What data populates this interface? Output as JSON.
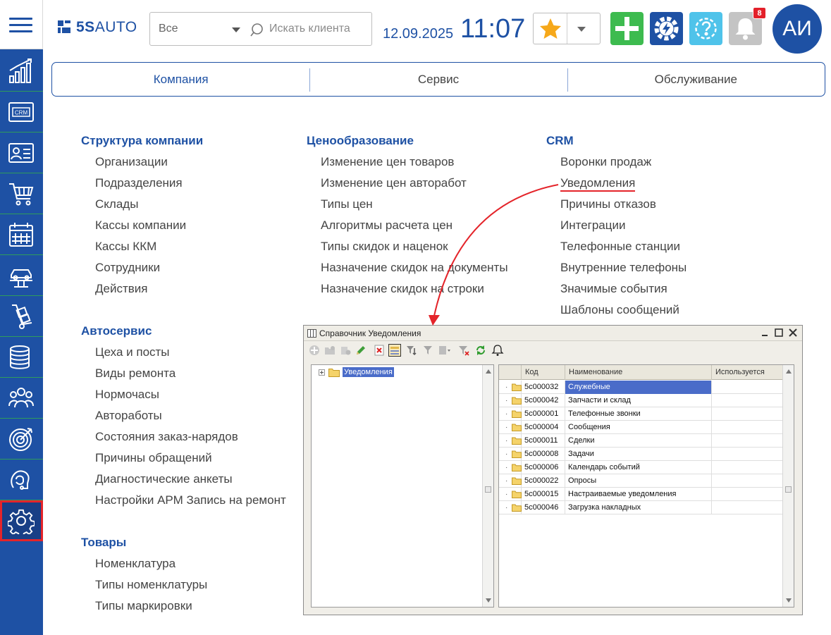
{
  "header": {
    "logo_text": "5SAUTO",
    "logo_brand": "5S",
    "logo_word": "AUTO",
    "scope_select": {
      "value": "Все"
    },
    "search": {
      "placeholder": "Искать клиента"
    },
    "date": "12.09.2025",
    "time": "11:07",
    "notification_count": "8",
    "avatar_initials": "АИ"
  },
  "sidebar": {
    "items": [
      {
        "name": "analytics",
        "icon": "chart-bars-icon"
      },
      {
        "name": "crm",
        "icon": "crm-icon",
        "label": "CRM"
      },
      {
        "name": "clients",
        "icon": "contact-card-icon"
      },
      {
        "name": "sales",
        "icon": "cart-icon"
      },
      {
        "name": "calendar",
        "icon": "calendar-icon"
      },
      {
        "name": "service",
        "icon": "car-lift-icon"
      },
      {
        "name": "warehouse",
        "icon": "hand-truck-icon"
      },
      {
        "name": "finance",
        "icon": "coins-icon"
      },
      {
        "name": "staff",
        "icon": "team-icon"
      },
      {
        "name": "marketing",
        "icon": "target-icon"
      },
      {
        "name": "support",
        "icon": "operator-icon"
      },
      {
        "name": "settings",
        "icon": "gear-icon",
        "active": true
      }
    ]
  },
  "tabs": [
    {
      "label": "Компания",
      "active": true
    },
    {
      "label": "Сервис"
    },
    {
      "label": "Обслуживание"
    }
  ],
  "sections": {
    "company": {
      "title": "Структура компании",
      "items": [
        "Организации",
        "Подразделения",
        "Склады",
        "Кассы компании",
        "Кассы ККМ",
        "Сотрудники",
        "Действия"
      ]
    },
    "pricing": {
      "title": "Ценообразование",
      "items": [
        "Изменение цен товаров",
        "Изменение цен авторабот",
        "Типы цен",
        "Алгоритмы расчета цен",
        "Типы скидок и наценок",
        "Назначение скидок на документы",
        "Назначение скидок на строки"
      ]
    },
    "crm": {
      "title": "CRM",
      "items": [
        "Воронки продаж",
        "Уведомления",
        "Причины отказов",
        "Интеграции",
        "Телефонные станции",
        "Внутренние телефоны",
        "Значимые события",
        "Шаблоны сообщений"
      ]
    },
    "autoservice": {
      "title": "Автосервис",
      "items": [
        "Цеха и посты",
        "Виды ремонта",
        "Нормочасы",
        "Автоработы",
        "Состояния заказ-нарядов",
        "Причины обращений",
        "Диагностические анкеты",
        "Настройки АРМ Запись на ремонт"
      ]
    },
    "goods": {
      "title": "Товары",
      "items": [
        "Номенклатура",
        "Типы номенклатуры",
        "Типы маркировки"
      ]
    }
  },
  "window": {
    "title": "Справочник Уведомления",
    "tree_root": "Уведомления",
    "columns": {
      "code": "Код",
      "name": "Наименование",
      "used": "Используется"
    },
    "rows": [
      {
        "code": "5c000032",
        "name": "Служебные",
        "selected": true
      },
      {
        "code": "5c000042",
        "name": "Запчасти и склад"
      },
      {
        "code": "5c000001",
        "name": "Телефонные звонки"
      },
      {
        "code": "5c000004",
        "name": "Сообщения"
      },
      {
        "code": "5c000011",
        "name": "Сделки"
      },
      {
        "code": "5c000008",
        "name": "Задачи"
      },
      {
        "code": "5c000006",
        "name": "Календарь событий"
      },
      {
        "code": "5c000022",
        "name": "Опросы"
      },
      {
        "code": "5c000015",
        "name": "Настраиваемые уведомления"
      },
      {
        "code": "5c000046",
        "name": "Загрузка накладных"
      }
    ]
  },
  "colors": {
    "brand_blue": "#1e51a4",
    "sidebar_divider": "#2f9c5b",
    "add_green": "#3dbb4f",
    "help_cyan": "#4fc3ea",
    "notify_gray": "#c4c4c4",
    "badge_red": "#e3202a",
    "highlight_red": "#e4242a",
    "selection_blue": "#4a6cc9"
  }
}
